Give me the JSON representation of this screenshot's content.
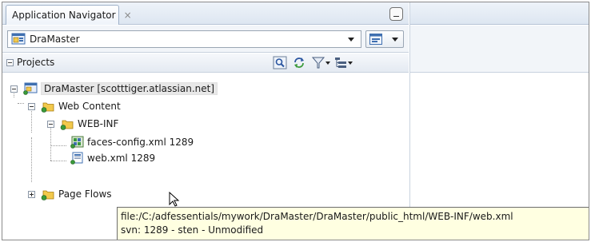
{
  "tab": {
    "label": "Application Navigator",
    "close_glyph": "×"
  },
  "application": {
    "name": "DraMaster"
  },
  "projects_panel": {
    "label": "Projects",
    "toolbar_icons": [
      "refresh-search-icon",
      "sync-icon",
      "filter-icon",
      "structure-options-icon"
    ]
  },
  "tree": {
    "root": {
      "label": "DraMaster [scotttiger.atlassian.net]",
      "icon": "project-icon",
      "expanded": true
    },
    "web_content": {
      "label": "Web Content",
      "icon": "folder-icon",
      "expanded": true
    },
    "web_inf": {
      "label": "WEB-INF",
      "icon": "folder-icon",
      "expanded": true
    },
    "faces_config": {
      "label": "faces-config.xml  1289",
      "icon": "xml-config-file-icon"
    },
    "web_xml": {
      "label": "web.xml  1289",
      "icon": "xml-file-icon"
    },
    "page_flows": {
      "label": "Page Flows",
      "icon": "folder-icon",
      "expanded": false
    }
  },
  "tooltip": {
    "line1": "file:/C:/adfessentials/mywork/DraMaster/DraMaster/public_html/WEB-INF/web.xml",
    "line2": "svn: 1289 - sten - Unmodified"
  },
  "colors": {
    "tooltip_bg": "#ffffe1",
    "selection_bg": "#e8e8e8",
    "folder_yellow": "#f2c94c",
    "svn_green": "#3a9a3a"
  }
}
